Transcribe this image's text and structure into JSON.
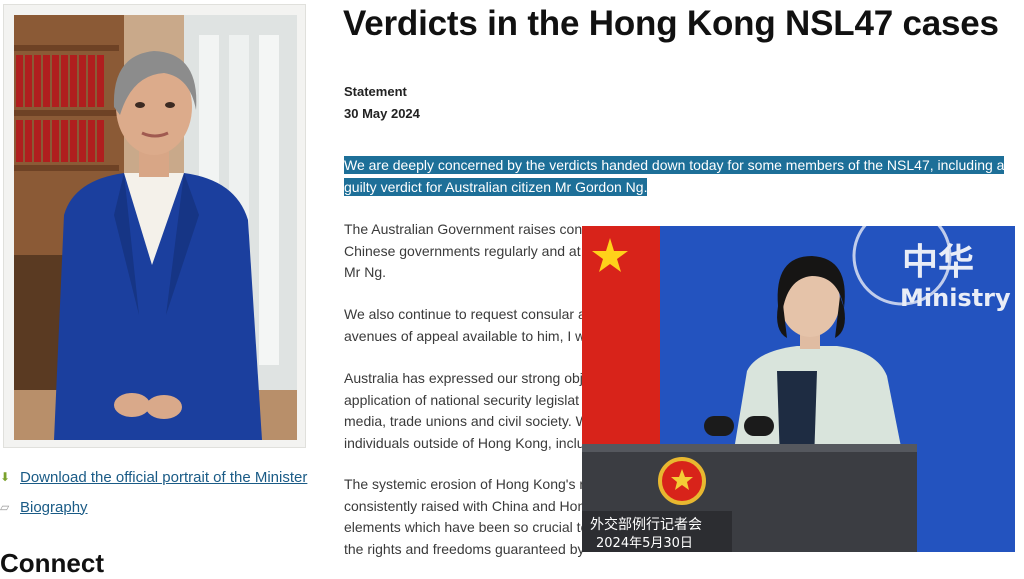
{
  "article": {
    "title": "Verdicts in the Hong Kong NSL47 cases",
    "type_label": "Statement",
    "date": "30 May 2024",
    "highlight_line1": "We are deeply concerned by the verdicts handed down today for some members of the NSL47, including a",
    "highlight_line2": "guilty verdict for Australian citizen Mr Gordon Ng.",
    "p2": [
      "The Australian Government raises cons",
      "Chinese governments regularly and at",
      "Mr Ng."
    ],
    "p3": [
      "We also continue to request consular a",
      "avenues of appeal available to him, I w"
    ],
    "p4": [
      "Australia has expressed our strong obj",
      "application of national security legislat",
      "media, trade unions and civil society. W",
      "individuals outside of Hong Kong, inclu"
    ],
    "p5": [
      "The systemic erosion of Hong Kong's r",
      "consistently raised with China and Hon",
      "elements which have been so crucial to",
      "the rights and freedoms guaranteed by"
    ]
  },
  "sidebar": {
    "download_link": "Download the official portrait of the Minister",
    "biography_link": "Biography",
    "connect_heading": "Connect"
  },
  "overlay": {
    "backdrop_text_cn": "中华",
    "backdrop_text_en": "Ministry",
    "caption_line1": "外交部例行记者会",
    "caption_line2": "2024年5月30日"
  },
  "colors": {
    "highlight": "#1d6f98",
    "link": "#1a5b86",
    "backdrop_blue": "#1f4fb8",
    "flag_red": "#d8231a"
  }
}
